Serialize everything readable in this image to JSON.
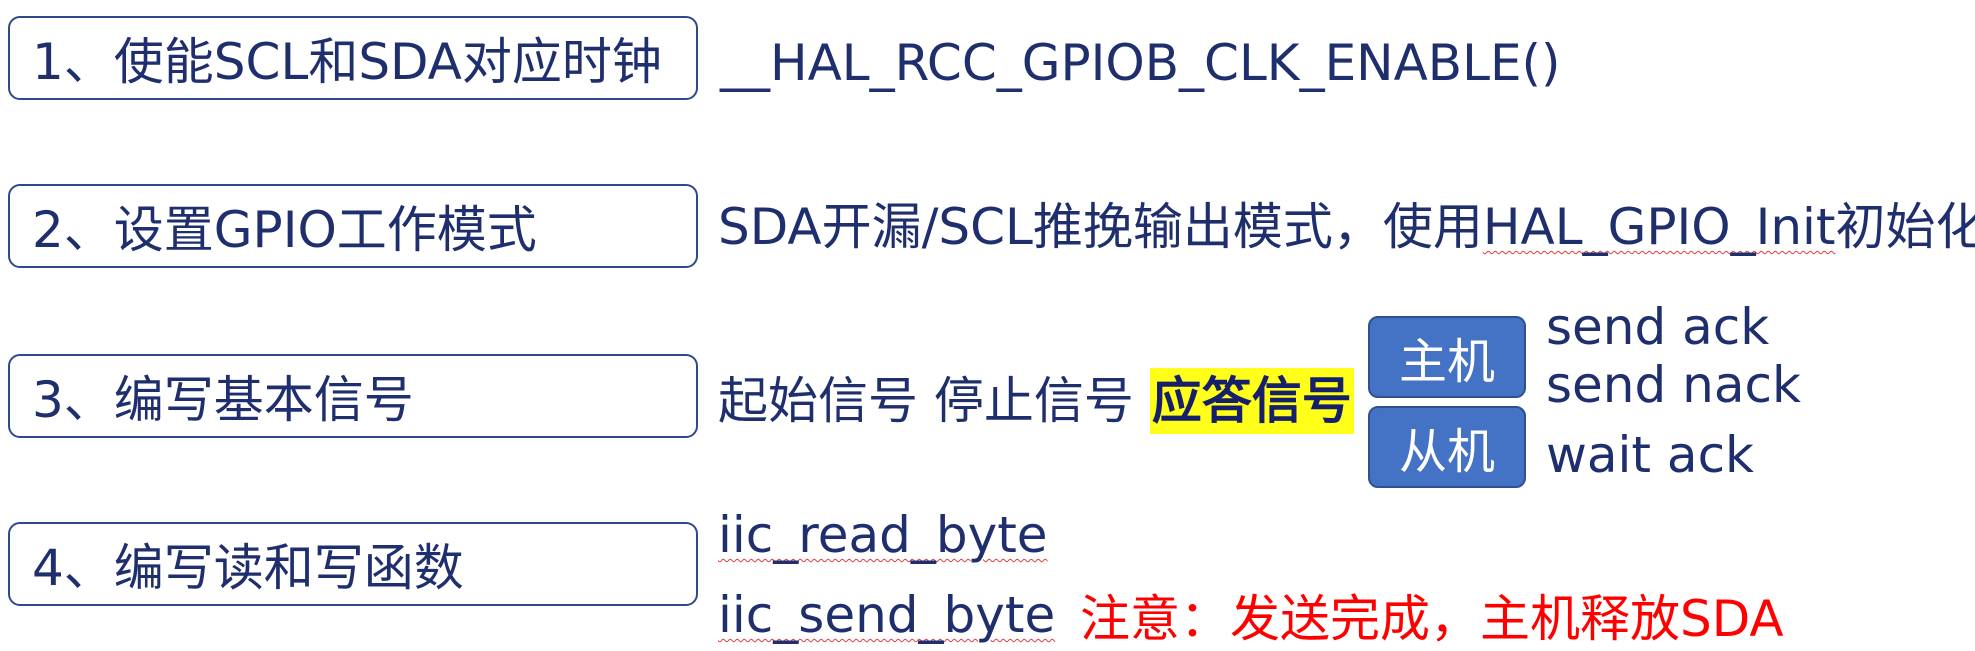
{
  "steps": [
    {
      "label": "1、使能SCL和SDA对应时钟",
      "detail": "__HAL_RCC_GPIOB_CLK_ENABLE()"
    },
    {
      "label": "2、设置GPIO工作模式",
      "detail_prefix": "SDA开漏/SCL推挽输出模式，使用",
      "detail_underlined": "HAL_GPIO_Init",
      "detail_suffix": "初始化"
    },
    {
      "label": "3、编写基本信号",
      "detail_plain": "起始信号 停止信号 ",
      "detail_highlight": "应答信号"
    },
    {
      "label": "4、编写读和写函数"
    }
  ],
  "roles": {
    "master_label": "主机",
    "slave_label": "从机",
    "master_items": [
      "send ack",
      "send nack"
    ],
    "slave_items": [
      "wait ack"
    ]
  },
  "functions": {
    "read": "iic_read_byte",
    "send": "iic_send_byte"
  },
  "note": "注意：发送完成，主机释放SDA",
  "colors": {
    "text": "#1f2f6e",
    "box_border": "#2f4a8a",
    "role_fill": "#4472c4",
    "highlight": "#ffff1a",
    "note": "#ff0000"
  }
}
